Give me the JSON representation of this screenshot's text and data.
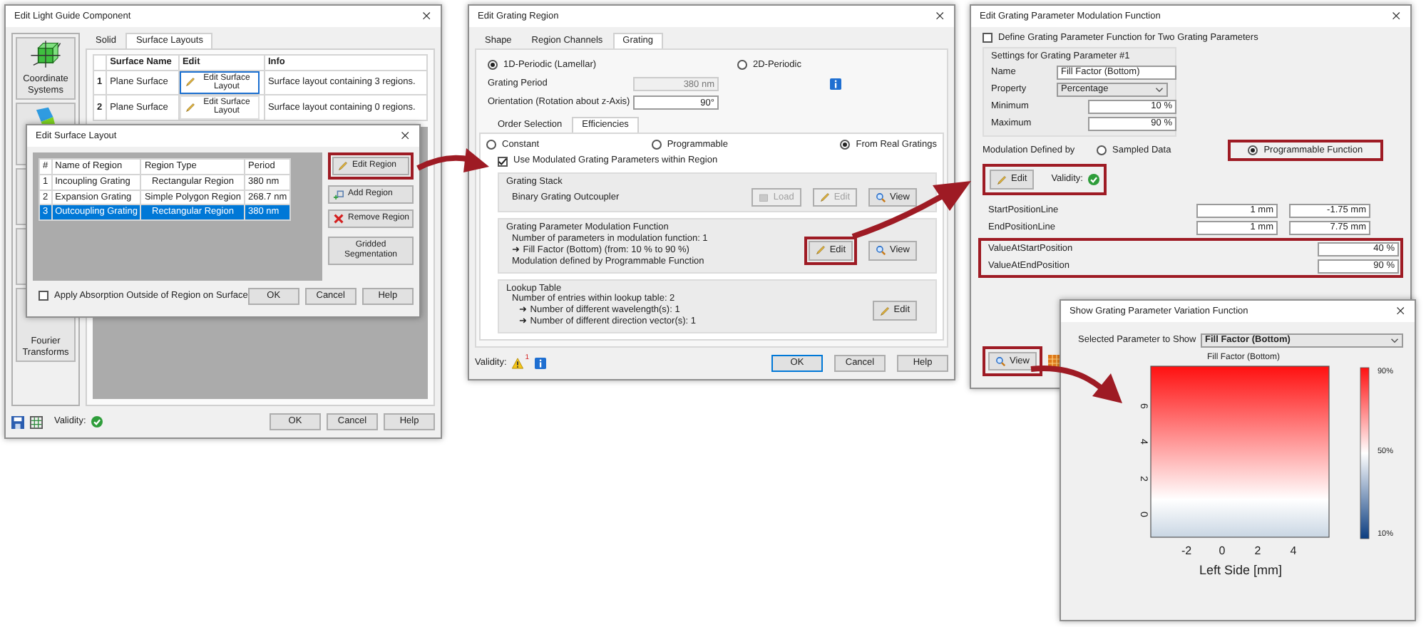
{
  "light_guide_window": {
    "title": "Edit Light Guide Component",
    "sidebar_items": [
      {
        "label": "Coordinate Systems"
      },
      {
        "label": "Fourier Transforms"
      }
    ],
    "tabs": [
      {
        "label": "Solid",
        "selected": false
      },
      {
        "label": "Surface Layouts",
        "selected": true
      }
    ],
    "table": {
      "columns": [
        "Surface Name",
        "Edit",
        "Info"
      ],
      "rows": [
        {
          "number": "1",
          "name": "Plane Surface",
          "edit": "Edit Surface Layout",
          "info": "Surface layout containing 3 regions.",
          "selected": true
        },
        {
          "number": "2",
          "name": "Plane Surface",
          "edit": "Edit Surface Layout",
          "info": "Surface layout containing 0 regions.",
          "selected": false
        }
      ]
    },
    "validity": "Validity:",
    "buttons": [
      "OK",
      "Cancel",
      "Help"
    ]
  },
  "surface_layout_dialog": {
    "title": "Edit Surface Layout",
    "table": {
      "columns": [
        "#",
        "Name of Region",
        "Region Type",
        "Period"
      ],
      "rows": [
        {
          "cells": [
            "1",
            "Incoupling Grating",
            "Rectangular Region",
            "380 nm"
          ],
          "selected": false
        },
        {
          "cells": [
            "2",
            "Expansion Grating",
            "Simple Polygon Region",
            "268.7 nm"
          ],
          "selected": false
        },
        {
          "cells": [
            "3",
            "Outcoupling Grating",
            "Rectangular Region",
            "380 nm"
          ],
          "selected": true
        }
      ]
    },
    "actions": [
      {
        "label": "Edit Region",
        "kind": "edit",
        "highlighted": true
      },
      {
        "label": "Add Region",
        "kind": "add",
        "highlighted": false
      },
      {
        "label": "Remove Region",
        "kind": "remove",
        "highlighted": false
      },
      {
        "label": "Gridded Segmentation",
        "kind": "plain",
        "highlighted": false
      }
    ],
    "absorption_checkbox": {
      "label": "Apply Absorption Outside of Region on Surface",
      "checked": false
    },
    "buttons": [
      "OK",
      "Cancel",
      "Help"
    ]
  },
  "grating_region_window": {
    "title": "Edit Grating Region",
    "tabs": [
      {
        "label": "Shape",
        "selected": false
      },
      {
        "label": "Region Channels",
        "selected": false
      },
      {
        "label": "Grating",
        "selected": true
      }
    ],
    "periodicity": [
      {
        "label": "1D-Periodic (Lamellar)",
        "selected": true
      },
      {
        "label": "2D-Periodic",
        "selected": false
      }
    ],
    "fields": [
      {
        "label": "Grating Period",
        "value": "380 nm",
        "disabled": true
      },
      {
        "label": "Orientation (Rotation about z-Axis)",
        "value": "90°",
        "disabled": false
      }
    ],
    "subtabs": [
      {
        "label": "Order Selection",
        "selected": false
      },
      {
        "label": "Efficiencies",
        "selected": true
      }
    ],
    "efficiency_modes": [
      {
        "label": "Constant",
        "selected": false
      },
      {
        "label": "Programmable",
        "selected": false
      },
      {
        "label": "From Real Gratings",
        "selected": true
      }
    ],
    "modulation_checkbox": {
      "label": "Use Modulated Grating Parameters within Region",
      "checked": true
    },
    "groups": [
      {
        "title": "Grating Stack",
        "lines": [
          {
            "text": "Binary Grating Outcoupler"
          }
        ],
        "buttons": [
          {
            "label": "Load",
            "kind": "load",
            "disabled": true,
            "highlighted": false
          },
          {
            "label": "Edit",
            "kind": "edit",
            "disabled": true,
            "highlighted": false
          },
          {
            "label": "View",
            "kind": "view",
            "disabled": false,
            "highlighted": false
          }
        ]
      },
      {
        "title": "Grating Parameter Modulation Function",
        "lines": [
          {
            "text": "Number of parameters in modulation function: 1"
          },
          {
            "text": "➜ Fill Factor (Bottom) (from: 10 % to 90 %)"
          },
          {
            "text": "Modulation defined by Programmable Function"
          }
        ],
        "buttons": [
          {
            "label": "Edit",
            "kind": "edit",
            "disabled": false,
            "highlighted": true
          },
          {
            "label": "View",
            "kind": "view",
            "disabled": false,
            "highlighted": false
          }
        ]
      },
      {
        "title": "Lookup Table",
        "lines": [
          {
            "text": "Number of entries within lookup table: 2",
            "children": [
              {
                "text": "➜ Number of different wavelength(s): 1"
              },
              {
                "text": "➜ Number of different direction vector(s): 1"
              }
            ]
          }
        ],
        "buttons": [
          {
            "label": "Edit",
            "kind": "edit",
            "disabled": false,
            "highlighted": false
          }
        ]
      }
    ],
    "validity": "Validity:",
    "warning_count": "1",
    "buttons": [
      "OK",
      "Cancel",
      "Help"
    ]
  },
  "modulation_window": {
    "title": "Edit Grating Parameter Modulation Function",
    "two_parameters_checkbox": {
      "label": "Define Grating Parameter Function for Two Grating Parameters",
      "checked": false
    },
    "settings_group": {
      "title": "Settings for Grating Parameter #1",
      "fields": [
        {
          "label": "Name",
          "value": "Fill Factor (Bottom)",
          "kind": "text"
        },
        {
          "label": "Property",
          "value": "Percentage",
          "kind": "select"
        },
        {
          "label": "Minimum",
          "value": "10 %",
          "kind": "number"
        },
        {
          "label": "Maximum",
          "value": "90 %",
          "kind": "number"
        }
      ]
    },
    "modulation_label": "Modulation Defined by",
    "modulation_options": [
      {
        "label": "Sampled Data",
        "selected": false,
        "highlighted": false
      },
      {
        "label": "Programmable Function",
        "selected": true,
        "highlighted": true
      }
    ],
    "function_edit": {
      "label": "Edit",
      "validity": "Validity:",
      "highlighted": true
    },
    "parameters": [
      {
        "label": "StartPositionLine",
        "values": [
          "1 mm",
          "-1.75 mm"
        ],
        "highlighted": false
      },
      {
        "label": "EndPositionLine",
        "values": [
          "1 mm",
          "7.75 mm"
        ],
        "highlighted": false
      },
      {
        "label": "ValueAtStartPosition",
        "values": [
          "40 %"
        ],
        "highlighted": true
      },
      {
        "label": "ValueAtEndPosition",
        "values": [
          "90 %"
        ],
        "highlighted": true
      }
    ],
    "view_button": {
      "label": "View",
      "highlighted": true
    }
  },
  "variation_window": {
    "title": "Show Grating Parameter Variation Function",
    "parameter_label": "Selected Parameter to Show",
    "parameter_value": "Fill Factor (Bottom)",
    "plot": {
      "title": "Fill Factor (Bottom)",
      "xlabel": "Left Side [mm]",
      "xticks": [
        "-2",
        "0",
        "2",
        "4"
      ],
      "yticks": [
        "0",
        "2",
        "4",
        "6"
      ],
      "colorbar_labels": [
        "90%",
        "50%",
        "10%"
      ]
    }
  }
}
